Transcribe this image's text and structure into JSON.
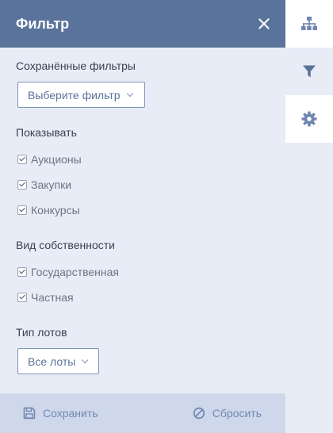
{
  "panel": {
    "title": "Фильтр"
  },
  "saved_filters": {
    "title": "Сохранённые фильтры",
    "select_value": "Выберите фильтр"
  },
  "show": {
    "title": "Показывать",
    "items": [
      {
        "label": "Аукционы",
        "checked": true
      },
      {
        "label": "Закупки",
        "checked": true
      },
      {
        "label": "Конкурсы",
        "checked": true
      }
    ]
  },
  "ownership": {
    "title": "Вид собственности",
    "items": [
      {
        "label": "Государственная",
        "checked": true
      },
      {
        "label": "Частная",
        "checked": true
      }
    ]
  },
  "lot_type": {
    "title": "Тип лотов",
    "select_value": "Все лоты"
  },
  "footer": {
    "save_label": "Сохранить",
    "reset_label": "Сбросить"
  },
  "rail": {
    "items": [
      {
        "icon": "hierarchy-icon"
      },
      {
        "icon": "filter-icon"
      },
      {
        "icon": "gear-icon"
      }
    ]
  },
  "colors": {
    "header": "#5a739b",
    "panel": "#e8ecf7",
    "footer": "#cfd8ea",
    "accent": "#7188b2"
  }
}
